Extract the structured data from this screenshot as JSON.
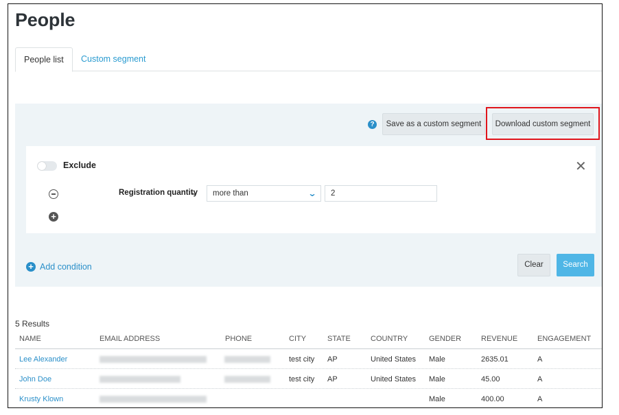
{
  "page": {
    "title": "People"
  },
  "tabs": [
    {
      "label": "People list",
      "active": true
    },
    {
      "label": "Custom segment",
      "active": false
    }
  ],
  "toolbar": {
    "help_icon": "question-circle-icon",
    "save_label": "Save as a custom segment",
    "download_label": "Download custom segment"
  },
  "condition": {
    "toggle_label": "Exclude",
    "toggle_on": false,
    "field_label": "Registration quantity",
    "operator": "more than",
    "value": "2"
  },
  "actions": {
    "add_condition_label": "Add condition",
    "clear_label": "Clear",
    "search_label": "Search"
  },
  "results": {
    "count_label": "5 Results",
    "columns": [
      "NAME",
      "EMAIL ADDRESS",
      "PHONE",
      "CITY",
      "STATE",
      "COUNTRY",
      "GENDER",
      "REVENUE",
      "ENGAGEMENT"
    ],
    "rows": [
      {
        "name": "Lee Alexander",
        "city": "test city",
        "state": "AP",
        "country": "United States",
        "gender": "Male",
        "revenue": "2635.01",
        "engagement": "A"
      },
      {
        "name": "John Doe",
        "city": "test city",
        "state": "AP",
        "country": "United States",
        "gender": "Male",
        "revenue": "45.00",
        "engagement": "A"
      },
      {
        "name": "Krusty Klown",
        "city": "",
        "state": "",
        "country": "",
        "gender": "Male",
        "revenue": "400.00",
        "engagement": "A"
      }
    ]
  },
  "colors": {
    "accent": "#2a8fc9",
    "search_button": "#4fb6e6",
    "panel_bg": "#eef4f7",
    "highlight": "#e0141b"
  }
}
